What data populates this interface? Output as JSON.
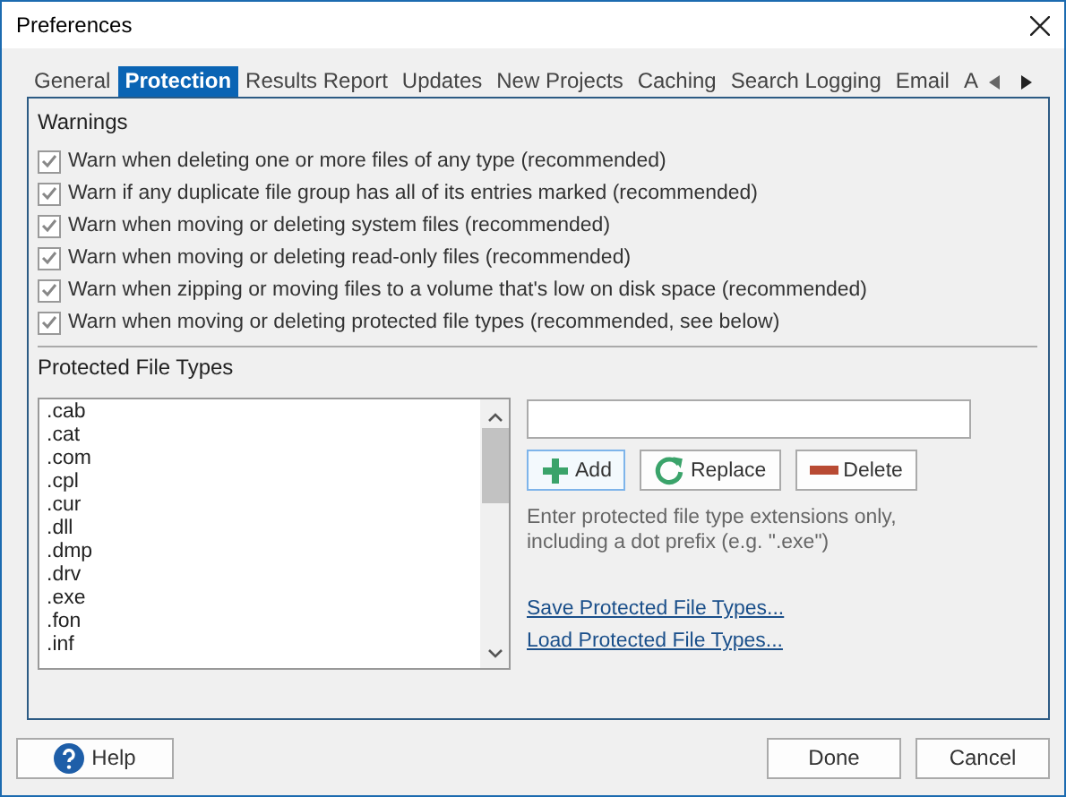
{
  "window": {
    "title": "Preferences"
  },
  "tabs": [
    {
      "label": "General",
      "selected": false
    },
    {
      "label": "Protection",
      "selected": true
    },
    {
      "label": "Results Report",
      "selected": false
    },
    {
      "label": "Updates",
      "selected": false
    },
    {
      "label": "New Projects",
      "selected": false
    },
    {
      "label": "Caching",
      "selected": false
    },
    {
      "label": "Search Logging",
      "selected": false
    },
    {
      "label": "Email",
      "selected": false
    },
    {
      "label": "A",
      "selected": false
    }
  ],
  "warnings": {
    "title": "Warnings",
    "options": [
      {
        "label": "Warn when deleting one or more files of any type (recommended)",
        "checked": true
      },
      {
        "label": "Warn if any duplicate file group has all of its entries marked (recommended)",
        "checked": true
      },
      {
        "label": "Warn when moving or deleting system files (recommended)",
        "checked": true
      },
      {
        "label": "Warn when moving or deleting read-only files (recommended)",
        "checked": true
      },
      {
        "label": "Warn when zipping or moving files to a volume that's low on disk space (recommended)",
        "checked": true
      },
      {
        "label": "Warn when moving or deleting protected file types (recommended, see below)",
        "checked": true
      }
    ]
  },
  "protected": {
    "title": "Protected File Types",
    "items": [
      ".cab",
      ".cat",
      ".com",
      ".cpl",
      ".cur",
      ".dll",
      ".dmp",
      ".drv",
      ".exe",
      ".fon",
      ".inf"
    ],
    "actions": [
      {
        "label": "Add",
        "kind": "add"
      },
      {
        "label": "Replace",
        "kind": "replace"
      },
      {
        "label": "Delete",
        "kind": "delete"
      }
    ],
    "hint": "Enter protected file type extensions only, including a dot prefix (e.g. \".exe\")",
    "links": [
      "Save Protected File Types...",
      "Load Protected File Types..."
    ]
  },
  "footer": {
    "help": "Help",
    "buttons": [
      "Done",
      "Cancel"
    ]
  }
}
